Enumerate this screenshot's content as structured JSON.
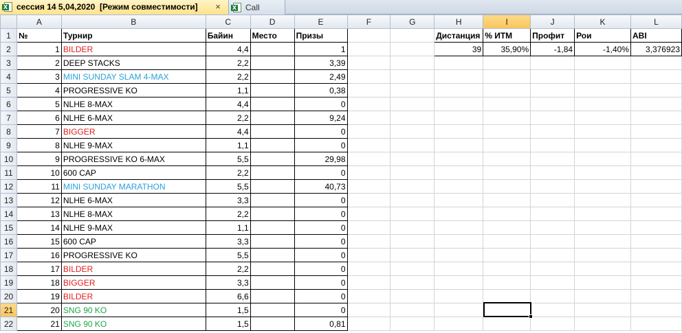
{
  "tabs": [
    {
      "title": "сессия 14 5,04,2020  [Режим совместимости]",
      "active": true,
      "close": "×"
    },
    {
      "title": "Call",
      "active": false
    }
  ],
  "columns": [
    "A",
    "B",
    "C",
    "D",
    "E",
    "F",
    "G",
    "H",
    "I",
    "J",
    "K",
    "L"
  ],
  "selected_column": "I",
  "selected_row": 21,
  "header_row": {
    "A": "№",
    "B": "Турнир",
    "C": "Байин",
    "D": "Место",
    "E": "Призы",
    "H": "Дистанция",
    "I": "% ИТМ",
    "J": "Профит",
    "K": "Рои",
    "L": "ABI"
  },
  "stats_row": {
    "H": "39",
    "I": "35,90%",
    "J": "-1,84",
    "K": "-1,40%",
    "L": "3,376923"
  },
  "rows": [
    {
      "n": "1",
      "name": "BILDER",
      "color": "red",
      "buyin": "4,4",
      "place": "",
      "prize": "1"
    },
    {
      "n": "2",
      "name": "DEEP STACKS",
      "color": "black",
      "buyin": "2,2",
      "place": "",
      "prize": "3,39"
    },
    {
      "n": "3",
      "name": "MINI SUNDAY SLAM 4-MAX",
      "color": "blue",
      "buyin": "2,2",
      "place": "",
      "prize": "2,49"
    },
    {
      "n": "4",
      "name": "PROGRESSIVE KO",
      "color": "black",
      "buyin": "1,1",
      "place": "",
      "prize": "0,38"
    },
    {
      "n": "5",
      "name": "NLHE 8-MAX",
      "color": "black",
      "buyin": "4,4",
      "place": "",
      "prize": "0"
    },
    {
      "n": "6",
      "name": "NLHE 6-MAX",
      "color": "black",
      "buyin": "2,2",
      "place": "",
      "prize": "9,24"
    },
    {
      "n": "7",
      "name": "BIGGER",
      "color": "red",
      "buyin": "4,4",
      "place": "",
      "prize": "0"
    },
    {
      "n": "8",
      "name": "NLHE 9-MAX",
      "color": "black",
      "buyin": "1,1",
      "place": "",
      "prize": "0"
    },
    {
      "n": "9",
      "name": "PROGRESSIVE KO 6-MAX",
      "color": "black",
      "buyin": "5,5",
      "place": "",
      "prize": "29,98"
    },
    {
      "n": "10",
      "name": "600 CAP",
      "color": "black",
      "buyin": "2,2",
      "place": "",
      "prize": "0"
    },
    {
      "n": "11",
      "name": "MINI SUNDAY MARATHON",
      "color": "blue",
      "buyin": "5,5",
      "place": "",
      "prize": "40,73"
    },
    {
      "n": "12",
      "name": "NLHE 6-MAX",
      "color": "black",
      "buyin": "3,3",
      "place": "",
      "prize": "0"
    },
    {
      "n": "13",
      "name": "NLHE 8-MAX",
      "color": "black",
      "buyin": "2,2",
      "place": "",
      "prize": "0"
    },
    {
      "n": "14",
      "name": "NLHE 9-MAX",
      "color": "black",
      "buyin": "1,1",
      "place": "",
      "prize": "0"
    },
    {
      "n": "15",
      "name": "600 CAP",
      "color": "black",
      "buyin": "3,3",
      "place": "",
      "prize": "0"
    },
    {
      "n": "16",
      "name": "PROGRESSIVE KO",
      "color": "black",
      "buyin": "5,5",
      "place": "",
      "prize": "0"
    },
    {
      "n": "17",
      "name": "BILDER",
      "color": "red",
      "buyin": "2,2",
      "place": "",
      "prize": "0"
    },
    {
      "n": "18",
      "name": "BIGGER",
      "color": "red",
      "buyin": "3,3",
      "place": "",
      "prize": "0"
    },
    {
      "n": "19",
      "name": "BILDER",
      "color": "red",
      "buyin": "6,6",
      "place": "",
      "prize": "0"
    },
    {
      "n": "20",
      "name": "SNG 90 KO",
      "color": "green",
      "buyin": "1,5",
      "place": "",
      "prize": "0"
    },
    {
      "n": "21",
      "name": "SNG 90 KO",
      "color": "green",
      "buyin": "1,5",
      "place": "",
      "prize": "0,81"
    }
  ],
  "colors": {
    "red": "#e02020",
    "blue": "#2aa1d8",
    "green": "#1fa34a",
    "black": "#000000",
    "header_highlight": "#f7c65b",
    "active_tab": "#ffe38d"
  }
}
